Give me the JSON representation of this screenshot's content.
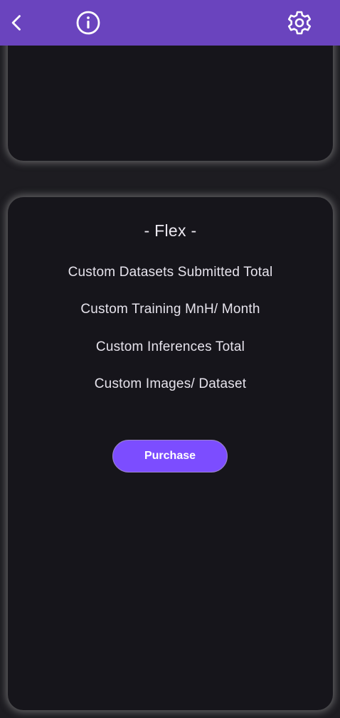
{
  "app_bar": {
    "back_icon": "chevron-left-icon",
    "info_icon": "info-circle-icon",
    "settings_icon": "gear-icon",
    "color": "#6a44be"
  },
  "plan": {
    "title": "- Flex -",
    "features": [
      "Custom Datasets Submitted Total",
      "Custom Training MnH/ Month",
      "Custom Inferences Total",
      "Custom Images/ Dataset"
    ],
    "purchase_label": "Purchase"
  },
  "colors": {
    "accent": "#7c4dff",
    "card_background": "#16151b",
    "text": "#e6e3ec"
  }
}
